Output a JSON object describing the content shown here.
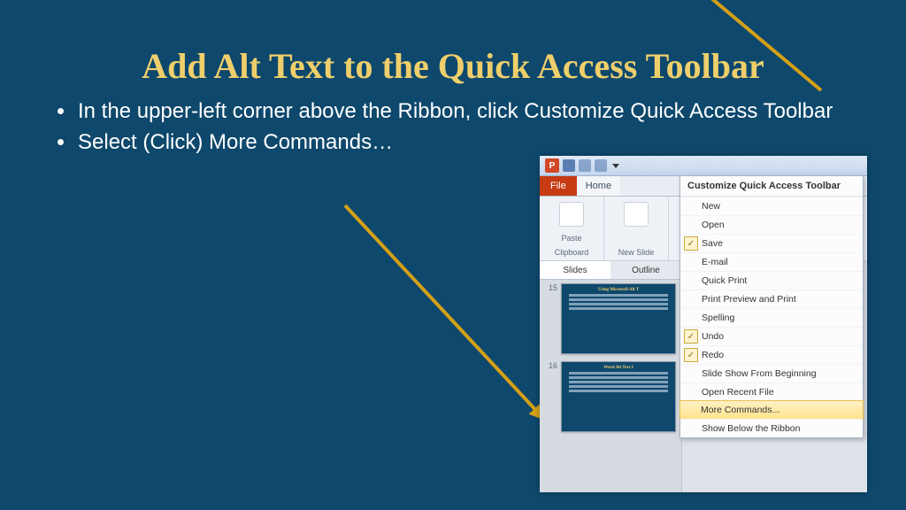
{
  "title": "Add Alt Text to the Quick Access Toolbar",
  "bullets": [
    "In the upper-left corner above the Ribbon, click Customize Quick Access Toolbar",
    "Select (Click) More Commands…"
  ],
  "mock": {
    "filetab": "File",
    "hometab": "Home",
    "paste": "Paste",
    "clipboard": "Clipboard",
    "newslide": "New Slide",
    "slidesTab": "Slides",
    "outlineTab": "Outline",
    "thumb1num": "15",
    "thumb1title": "Using Microsoft Alt T",
    "thumb2num": "16",
    "thumb2title": "Word Alt Text I"
  },
  "menu": {
    "header": "Customize Quick Access Toolbar",
    "items": [
      {
        "label": "New",
        "chk": false
      },
      {
        "label": "Open",
        "chk": false
      },
      {
        "label": "Save",
        "chk": true
      },
      {
        "label": "E-mail",
        "chk": false
      },
      {
        "label": "Quick Print",
        "chk": false
      },
      {
        "label": "Print Preview and Print",
        "chk": false
      },
      {
        "label": "Spelling",
        "chk": false
      },
      {
        "label": "Undo",
        "chk": true
      },
      {
        "label": "Redo",
        "chk": true
      },
      {
        "label": "Slide Show From Beginning",
        "chk": false
      },
      {
        "label": "Open Recent File",
        "chk": false
      },
      {
        "label": "More Commands...",
        "chk": false,
        "hl": true
      },
      {
        "label": "Show Below the Ribbon",
        "chk": false
      }
    ]
  }
}
